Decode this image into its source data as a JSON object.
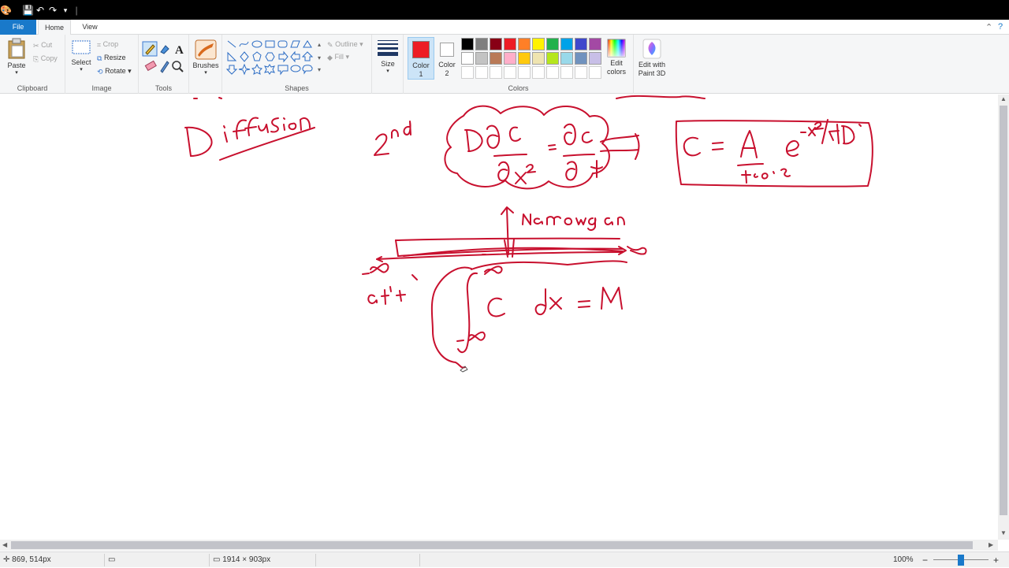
{
  "menu": {
    "file_label": "File",
    "home_label": "Home",
    "view_label": "View"
  },
  "clipboard": {
    "paste_label": "Paste",
    "cut_label": "Cut",
    "copy_label": "Copy",
    "group_label": "Clipboard"
  },
  "image": {
    "select_label": "Select",
    "crop_label": "Crop",
    "resize_label": "Resize",
    "rotate_label": "Rotate",
    "group_label": "Image"
  },
  "tools": {
    "group_label": "Tools"
  },
  "brushes": {
    "label": "Brushes"
  },
  "shapes": {
    "outline_label": "Outline",
    "fill_label": "Fill",
    "group_label": "Shapes"
  },
  "size": {
    "label": "Size"
  },
  "colors": {
    "color1_label": "Color 1",
    "color2_label": "Color 2",
    "edit_colors_label": "Edit colors",
    "group_label": "Colors",
    "color1_value": "#ed1c24",
    "color2_value": "#ffffff",
    "palette": [
      "#000000",
      "#7f7f7f",
      "#880015",
      "#ed1c24",
      "#ff7f27",
      "#fff200",
      "#22b14c",
      "#00a2e8",
      "#3f48cc",
      "#a349a4",
      "#ffffff",
      "#c3c3c3",
      "#b97a57",
      "#ffaec9",
      "#ffc90e",
      "#efe4b0",
      "#b5e61d",
      "#99d9ea",
      "#7092be",
      "#c8bfe7"
    ]
  },
  "paint3d": {
    "label": "Edit with Paint 3D"
  },
  "ink_color": "#c8102e",
  "status": {
    "cursor_position": "869, 514px",
    "image_size": "1914 × 903px",
    "zoom": "100%",
    "zoom_level": 1.0
  }
}
